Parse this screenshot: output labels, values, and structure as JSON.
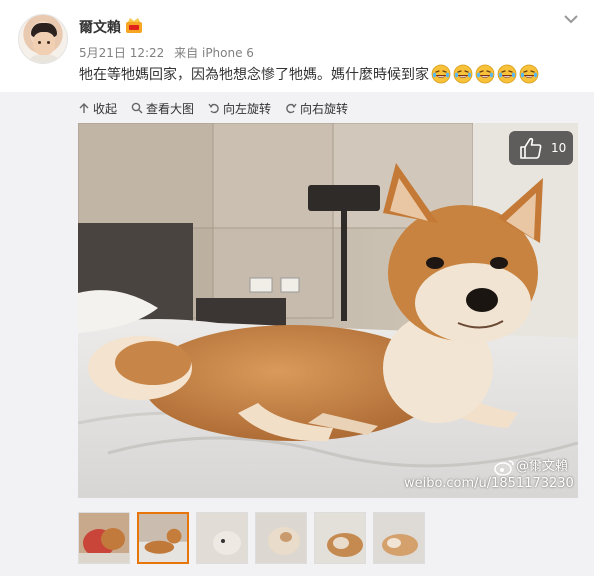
{
  "post": {
    "username": "爾文賴",
    "timestamp": "5月21日 12:22",
    "source_prefix": "来自",
    "source": "iPhone 6",
    "text": "牠在等牠媽回家，因為牠想念慘了牠媽。媽什麼時候到家",
    "emoji_names": [
      "laughing-tears-emoji",
      "laughing-tears-emoji",
      "laughing-tears-emoji",
      "laughing-tears-emoji",
      "laughing-tears-emoji"
    ]
  },
  "toolbar": {
    "collapse_label": "收起",
    "view_large_label": "查看大图",
    "rotate_left_label": "向左旋转",
    "rotate_right_label": "向右旋转"
  },
  "photo": {
    "like_count": "10",
    "watermark_handle": "@爾文賴",
    "watermark_url": "weibo.com/u/1851173230"
  },
  "thumbnails": {
    "count": 6,
    "active_index": 1
  },
  "colors": {
    "accent_orange": "#e8750a",
    "media_bg": "#f2f2f5",
    "meta_gray": "#808080"
  }
}
